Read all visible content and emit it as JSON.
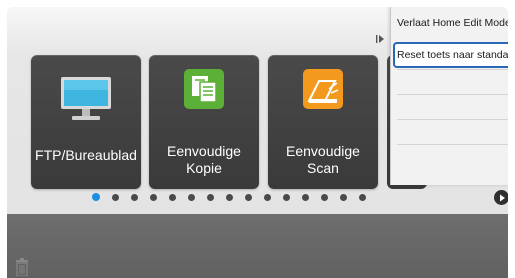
{
  "tiles": [
    {
      "label_lines": [
        "FTP/Bureaublad"
      ],
      "icon": "monitor-icon"
    },
    {
      "label_lines": [
        "Eenvoudige",
        "Kopie"
      ],
      "icon": "copy-icon",
      "icon_color": "#5cb037"
    },
    {
      "label_lines": [
        "Eenvoudige",
        "Scan"
      ],
      "icon": "scan-icon",
      "icon_color": "#f39a1e"
    }
  ],
  "pagination": {
    "page_count": 15,
    "active_page": 1,
    "next_icon": "chevron-right-icon"
  },
  "side_menu": {
    "items": [
      {
        "label": "Verlaat Home Edit Mode"
      },
      {
        "label": "Reset toets naar standaard",
        "highlighted": true
      }
    ],
    "toggle_icon": "collapse-menu-icon"
  },
  "bottom_bar": {
    "trash_icon": "trash-icon"
  },
  "colors": {
    "accent": "#1e8ee0",
    "highlight_border": "#2a67b5",
    "tile": "#3f3f3f"
  }
}
